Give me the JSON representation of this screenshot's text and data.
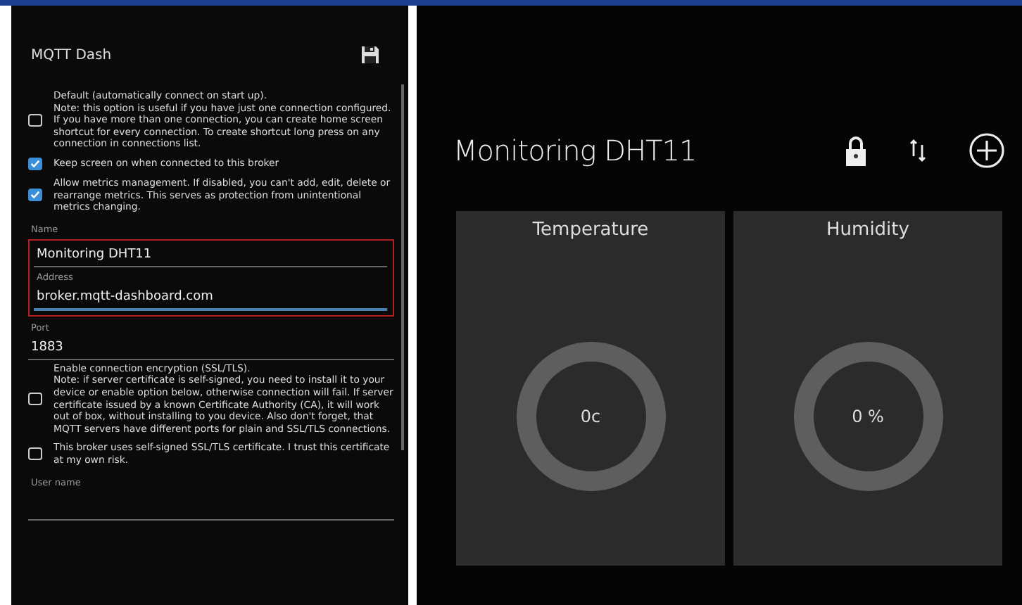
{
  "settings_screen": {
    "title": "MQTT Dash",
    "options_top": [
      {
        "text": "Default (automatically connect on start up).\nNote: this option is useful if you have just one connection configured.\nIf you have more than one connection, you can create home screen shortcut for every connection. To create shortcut long press on any connection in connections list.",
        "checked": false
      },
      {
        "text": "Keep screen on when connected to this broker",
        "checked": true
      },
      {
        "text": "Allow metrics management. If disabled, you can't add, edit, delete or rearrange metrics. This serves as protection from unintentional metrics changing.",
        "checked": true
      }
    ],
    "name_field": {
      "label": "Name",
      "value": "Monitoring DHT11"
    },
    "address_field": {
      "label": "Address",
      "value": "broker.mqtt-dashboard.com"
    },
    "port_field": {
      "label": "Port",
      "value": "1883"
    },
    "options_bottom": [
      {
        "text": "Enable connection encryption (SSL/TLS).\nNote: if server certificate is self-signed, you need to install it to your device or enable option below, otherwise connection will fail. If server certificate issued by a known Certificate Authority (CA), it will work out of box, without installing to you device. Also don't forget, that MQTT servers have different ports for plain and SSL/TLS connections.",
        "checked": false
      },
      {
        "text": "This broker uses self-signed SSL/TLS certificate. I trust this certificate at my own risk.",
        "checked": false
      }
    ],
    "user_name_field": {
      "label": "User name"
    }
  },
  "dashboard_screen": {
    "title": "Monitoring DHT11",
    "tiles": [
      {
        "name": "Temperature",
        "value": "0c"
      },
      {
        "name": "Humidity",
        "value": "0 %"
      }
    ]
  }
}
